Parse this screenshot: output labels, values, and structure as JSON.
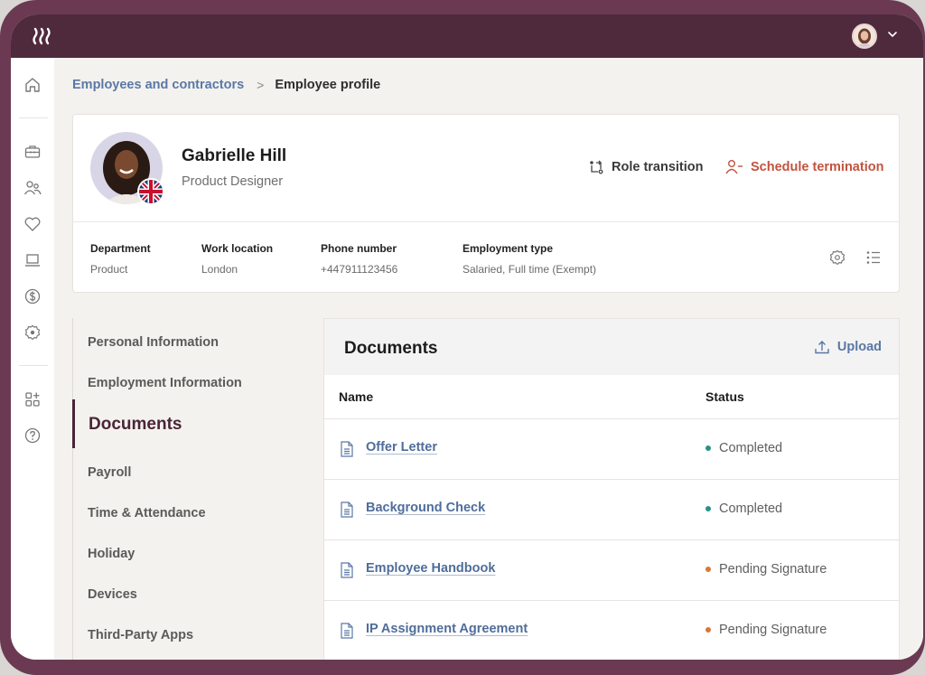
{
  "app": {
    "logo_icon": "brand-waves-icon",
    "user_menu_icon": "chevron-down-icon"
  },
  "rail": {
    "items": [
      {
        "name": "home",
        "icon": "home-icon"
      },
      {
        "name": "jobs",
        "icon": "briefcase-icon"
      },
      {
        "name": "people",
        "icon": "people-icon"
      },
      {
        "name": "benefits",
        "icon": "heart-icon"
      },
      {
        "name": "devices",
        "icon": "laptop-icon"
      },
      {
        "name": "payroll",
        "icon": "dollar-circle-icon"
      },
      {
        "name": "settings",
        "icon": "gear-icon"
      },
      {
        "name": "apps",
        "icon": "add-apps-icon"
      },
      {
        "name": "help",
        "icon": "help-circle-icon"
      }
    ]
  },
  "breadcrumb": {
    "parent": "Employees and contractors",
    "separator": ">",
    "current": "Employee profile"
  },
  "profile": {
    "name": "Gabrielle Hill",
    "role": "Product Designer",
    "country_flag": "United Kingdom",
    "actions": {
      "role_transition": "Role transition",
      "schedule_termination": "Schedule termination"
    },
    "details": [
      {
        "label": "Department",
        "value": "Product"
      },
      {
        "label": "Work location",
        "value": "London"
      },
      {
        "label": "Phone number",
        "value": "+447911123456"
      },
      {
        "label": "Employment type",
        "value": "Salaried, Full time (Exempt)"
      }
    ]
  },
  "subnav": {
    "items": [
      {
        "label": "Personal Information",
        "active": false
      },
      {
        "label": "Employment Information",
        "active": false
      },
      {
        "label": "Documents",
        "active": true
      },
      {
        "label": "Payroll",
        "active": false
      },
      {
        "label": "Time & Attendance",
        "active": false
      },
      {
        "label": "Holiday",
        "active": false
      },
      {
        "label": "Devices",
        "active": false
      },
      {
        "label": "Third-Party Apps",
        "active": false
      }
    ]
  },
  "documents": {
    "title": "Documents",
    "upload_label": "Upload",
    "columns": {
      "name": "Name",
      "status": "Status"
    },
    "rows": [
      {
        "name": "Offer Letter",
        "status": "Completed",
        "status_color": "#2a9186"
      },
      {
        "name": "Background Check",
        "status": "Completed",
        "status_color": "#2a9186"
      },
      {
        "name": "Employee Handbook",
        "status": "Pending Signature",
        "status_color": "#d9773a"
      },
      {
        "name": "IP Assignment Agreement",
        "status": "Pending Signature",
        "status_color": "#d9773a"
      }
    ]
  },
  "colors": {
    "brand": "#4f2a3c",
    "frame": "#6b3a52",
    "link": "#5a78a6",
    "danger": "#c2533f",
    "completed": "#2a9186",
    "pending": "#d9773a"
  }
}
